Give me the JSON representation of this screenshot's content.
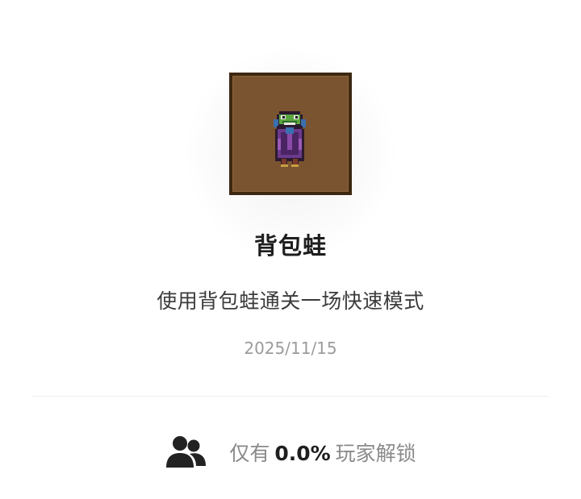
{
  "achievement": {
    "icon": "backpack-frog-pixel-icon",
    "title": "背包蛙",
    "description": "使用背包蛙通关一场快速模式",
    "date": "2025/11/15"
  },
  "unlock_stats": {
    "icon": "users-icon",
    "prefix": "仅有",
    "percentage": "0.0%",
    "suffix": "玩家解锁"
  },
  "colors": {
    "icon_background": "#7a5430",
    "icon_border": "#3d2812",
    "title": "#1e1e1e",
    "muted": "#8a8a8a"
  }
}
